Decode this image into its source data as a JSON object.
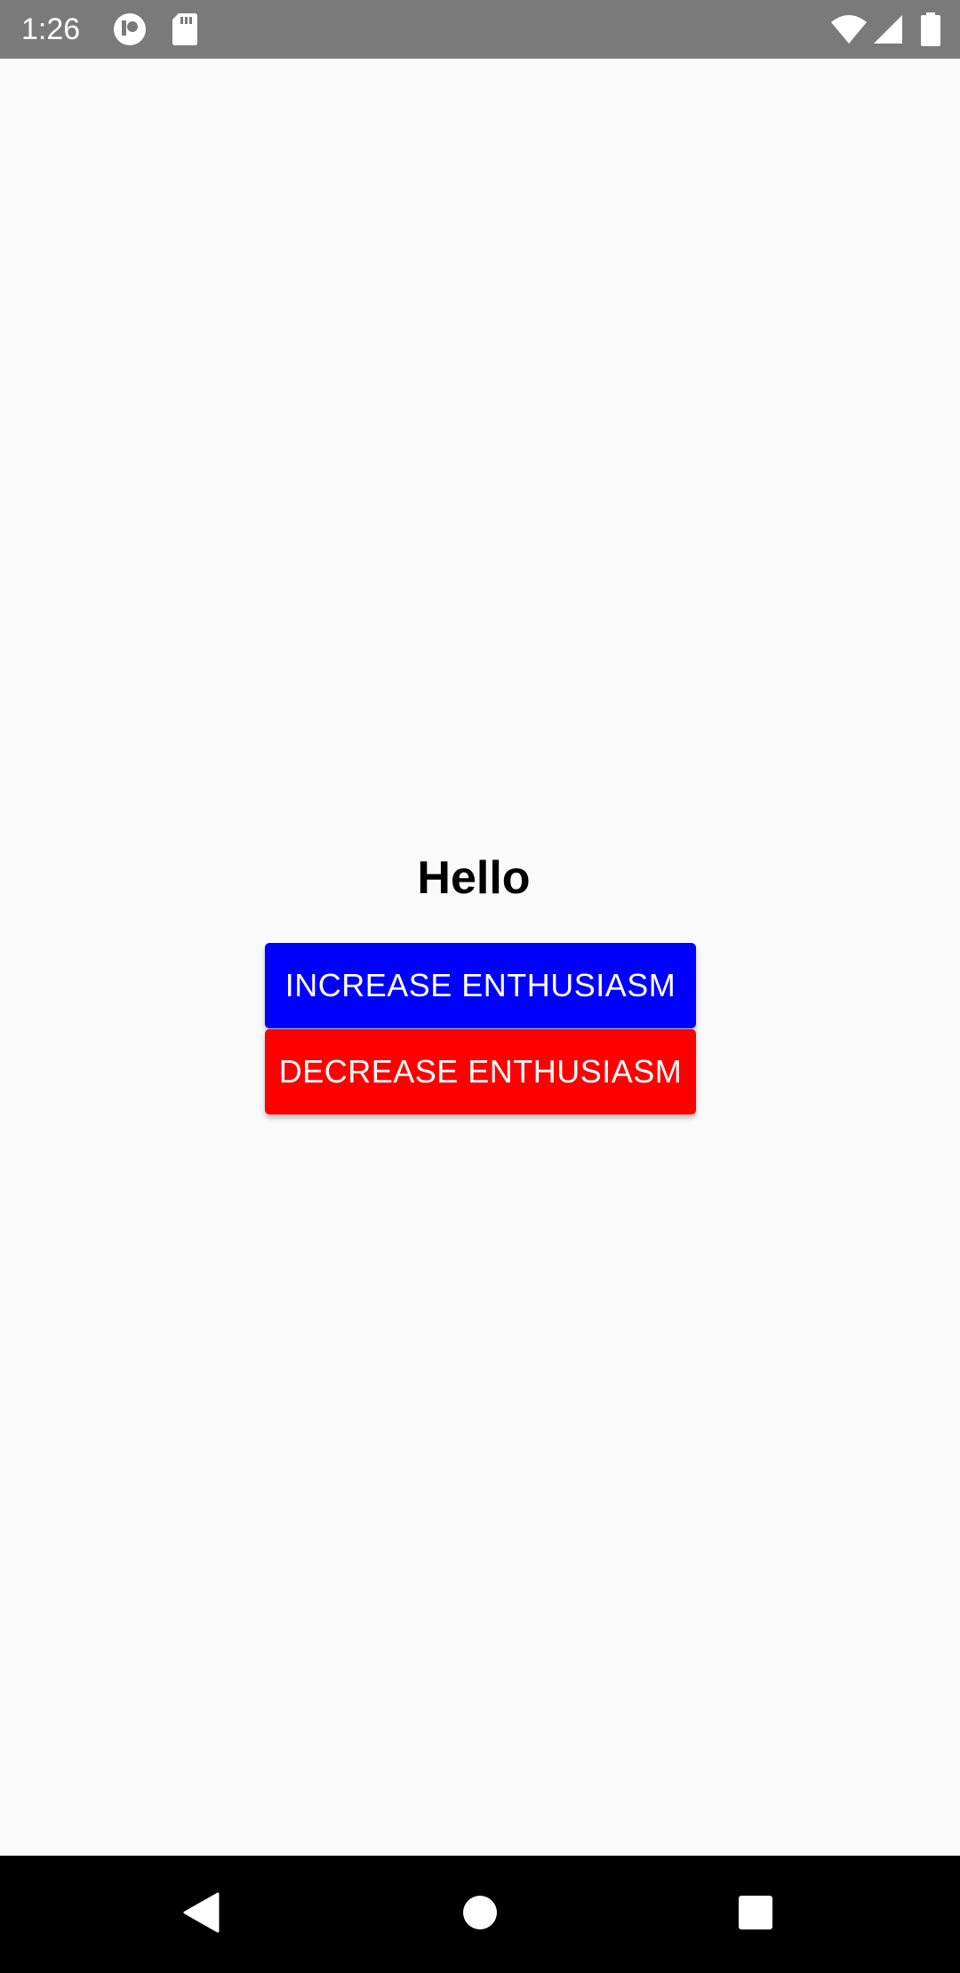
{
  "status_bar": {
    "time": "1:26",
    "left_icons": [
      "app-notification-icon",
      "sd-card-icon"
    ],
    "right_icons": [
      "wifi-icon",
      "cell-signal-icon",
      "battery-icon"
    ],
    "background": "#7a7a7a"
  },
  "main": {
    "greeting": "Hello",
    "increase_button": {
      "label": "INCREASE ENTHUSIASM",
      "color": "#0000ff"
    },
    "decrease_button": {
      "label": "DECREASE ENTHUSIASM",
      "color": "#ff0000"
    }
  },
  "nav_bar": {
    "buttons": [
      "back-icon",
      "home-icon",
      "recents-icon"
    ],
    "background": "#000000"
  }
}
